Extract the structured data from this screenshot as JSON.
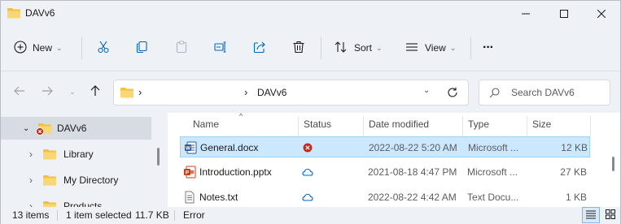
{
  "window": {
    "title": "DAVv6"
  },
  "toolbar": {
    "new_label": "New",
    "sort_label": "Sort",
    "view_label": "View",
    "more_label": "···"
  },
  "address": {
    "separator": "›",
    "current": "DAVv6"
  },
  "search": {
    "placeholder": "Search DAVv6"
  },
  "navpane": {
    "items": [
      {
        "label": "DAVv6",
        "icon": "folder-error-icon",
        "selected": true
      },
      {
        "label": "Library",
        "icon": "folder-icon"
      },
      {
        "label": "My Directory",
        "icon": "folder-icon"
      },
      {
        "label": "Products",
        "icon": "folder-icon"
      }
    ]
  },
  "columns": {
    "name": "Name",
    "status": "Status",
    "date_modified": "Date modified",
    "type": "Type",
    "size": "Size"
  },
  "files": [
    {
      "name": "General.docx",
      "icon": "word-doc-icon",
      "status": "error-icon",
      "date": "2022-08-22 5:20 AM",
      "type": "Microsoft ...",
      "size": "12 KB",
      "selected": true
    },
    {
      "name": "Introduction.pptx",
      "icon": "powerpoint-doc-icon",
      "status": "cloud-icon",
      "date": "2021-08-18 4:47 PM",
      "type": "Microsoft ...",
      "size": "27 KB"
    },
    {
      "name": "Notes.txt",
      "icon": "text-doc-icon",
      "status": "cloud-icon",
      "date": "2022-08-22 4:42 AM",
      "type": "Text Docu...",
      "size": "1 KB"
    }
  ],
  "statusbar": {
    "items_count": "13 items",
    "selected": "1 item selected",
    "selected_size": "11.7 KB",
    "state": "Error"
  },
  "colors": {
    "accent": "#0067c0",
    "error": "#c42b1c",
    "folder": "#f3c03f",
    "selection": "#cce8ff"
  }
}
